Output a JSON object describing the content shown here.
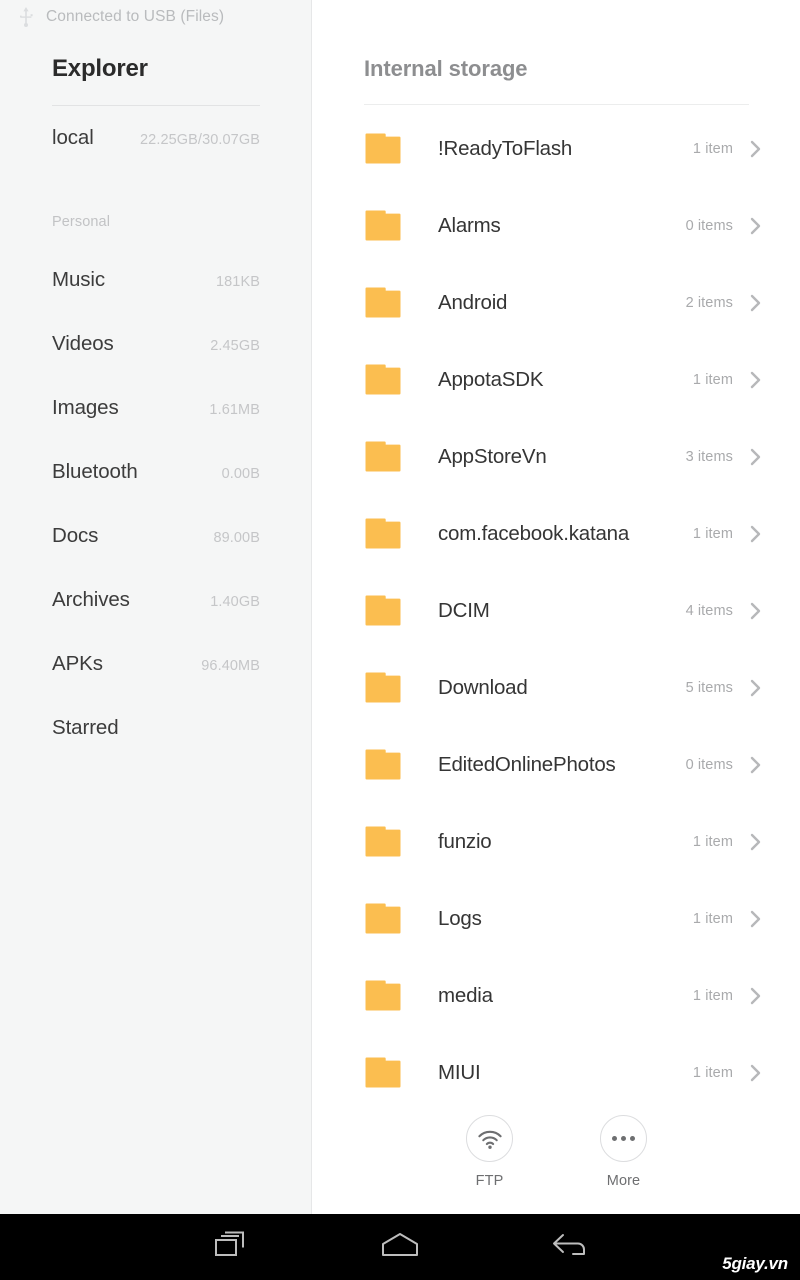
{
  "statusbar": {
    "usb_icon": "usb-icon",
    "usb_text": "Connected to USB (Files)"
  },
  "sidebar": {
    "title": "Explorer",
    "storage": {
      "label": "local",
      "value": "22.25GB/30.07GB"
    },
    "section_label": "Personal",
    "items": [
      {
        "label": "Music",
        "value": "181KB"
      },
      {
        "label": "Videos",
        "value": "2.45GB"
      },
      {
        "label": "Images",
        "value": "1.61MB"
      },
      {
        "label": "Bluetooth",
        "value": "0.00B"
      },
      {
        "label": "Docs",
        "value": "89.00B"
      },
      {
        "label": "Archives",
        "value": "1.40GB"
      },
      {
        "label": "APKs",
        "value": "96.40MB"
      },
      {
        "label": "Starred",
        "value": ""
      }
    ]
  },
  "main": {
    "title": "Internal storage",
    "files": [
      {
        "name": "!ReadyToFlash",
        "count": "1 item",
        "icon": "folder-icon"
      },
      {
        "name": "Alarms",
        "count": "0 items",
        "icon": "folder-icon"
      },
      {
        "name": "Android",
        "count": "2 items",
        "icon": "folder-icon"
      },
      {
        "name": "AppotaSDK",
        "count": "1 item",
        "icon": "folder-icon"
      },
      {
        "name": "AppStoreVn",
        "count": "3 items",
        "icon": "folder-icon"
      },
      {
        "name": "com.facebook.katana",
        "count": "1 item",
        "icon": "folder-icon"
      },
      {
        "name": "DCIM",
        "count": "4 items",
        "icon": "folder-icon"
      },
      {
        "name": "Download",
        "count": "5 items",
        "icon": "folder-icon"
      },
      {
        "name": "EditedOnlinePhotos",
        "count": "0 items",
        "icon": "folder-icon"
      },
      {
        "name": "funzio",
        "count": "1 item",
        "icon": "folder-icon"
      },
      {
        "name": "Logs",
        "count": "1 item",
        "icon": "folder-icon"
      },
      {
        "name": "media",
        "count": "1 item",
        "icon": "folder-icon"
      },
      {
        "name": "MIUI",
        "count": "1 item",
        "icon": "folder-icon"
      }
    ]
  },
  "actions": [
    {
      "label": "FTP",
      "icon": "wifi-icon"
    },
    {
      "label": "More",
      "icon": "more-dots-icon"
    }
  ],
  "navbar": {
    "recent_icon": "recent-apps-icon",
    "home_icon": "home-icon",
    "back_icon": "back-icon",
    "watermark": "5giay.vn"
  },
  "colors": {
    "folder": "#fbbe50",
    "sidebar_bg": "#f5f6f6",
    "main_bg": "#ffffff",
    "navbar_bg": "#000000"
  }
}
